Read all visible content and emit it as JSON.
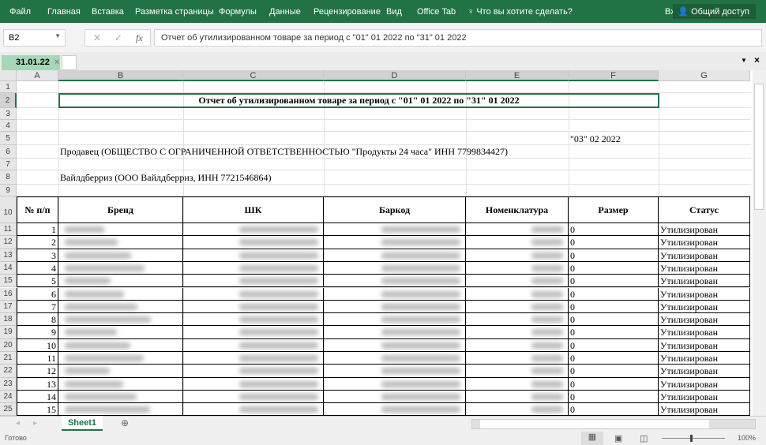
{
  "ribbon": {
    "tabs": [
      "Файл",
      "Главная",
      "Вставка",
      "Разметка страницы",
      "Формулы",
      "Данные",
      "Рецензирование",
      "Вид",
      "Office Tab"
    ],
    "tell_me": "Что вы хотите сделать?",
    "signin": "Вход",
    "share": "Общий доступ",
    "color": "#217346"
  },
  "formula_bar": {
    "name_box": "B2",
    "fx": "fx",
    "formula": "Отчет об утилизированном товаре за период с \"01\" 01 2022 по \"31\" 01 2022"
  },
  "doc_tab": {
    "label": "31.01.22"
  },
  "columns": [
    "A",
    "B",
    "C",
    "D",
    "E",
    "F",
    "G"
  ],
  "report": {
    "title": "Отчет об утилизированном товаре за период с \"01\" 01 2022 по \"31\" 01 2022",
    "date": "\"03\" 02 2022",
    "seller": "Продавец (ОБЩЕСТВО С ОГРАНИЧЕННОЙ ОТВЕТСТВЕННОСТЬЮ \"Продукты 24 часа\" ИНН 7799834427)",
    "buyer": "Вайлдберриз (ООО Вайлдберриз, ИНН 7721546864)",
    "headers": [
      "№ п/п",
      "Бренд",
      "ШК",
      "Баркод",
      "Номенклатура",
      "Размер",
      "Статус"
    ],
    "rows": [
      {
        "n": "1",
        "size": "0",
        "status": "Утилизирован"
      },
      {
        "n": "2",
        "size": "0",
        "status": "Утилизирован"
      },
      {
        "n": "3",
        "size": "0",
        "status": "Утилизирован"
      },
      {
        "n": "4",
        "size": "0",
        "status": "Утилизирован"
      },
      {
        "n": "5",
        "size": "0",
        "status": "Утилизирован"
      },
      {
        "n": "6",
        "size": "0",
        "status": "Утилизирован"
      },
      {
        "n": "7",
        "size": "0",
        "status": "Утилизирован"
      },
      {
        "n": "8",
        "size": "0",
        "status": "Утилизирован"
      },
      {
        "n": "9",
        "size": "0",
        "status": "Утилизирован"
      },
      {
        "n": "10",
        "size": "0",
        "status": "Утилизирован"
      },
      {
        "n": "11",
        "size": "0",
        "status": "Утилизирован"
      },
      {
        "n": "12",
        "size": "0",
        "status": "Утилизирован"
      },
      {
        "n": "13",
        "size": "0",
        "status": "Утилизирован"
      },
      {
        "n": "14",
        "size": "0",
        "status": "Утилизирован"
      },
      {
        "n": "15",
        "size": "0",
        "status": "Утилизирован"
      }
    ]
  },
  "sheets": [
    "Sheet1"
  ],
  "status_bar": {
    "ready": "Готово",
    "zoom": "100%"
  }
}
